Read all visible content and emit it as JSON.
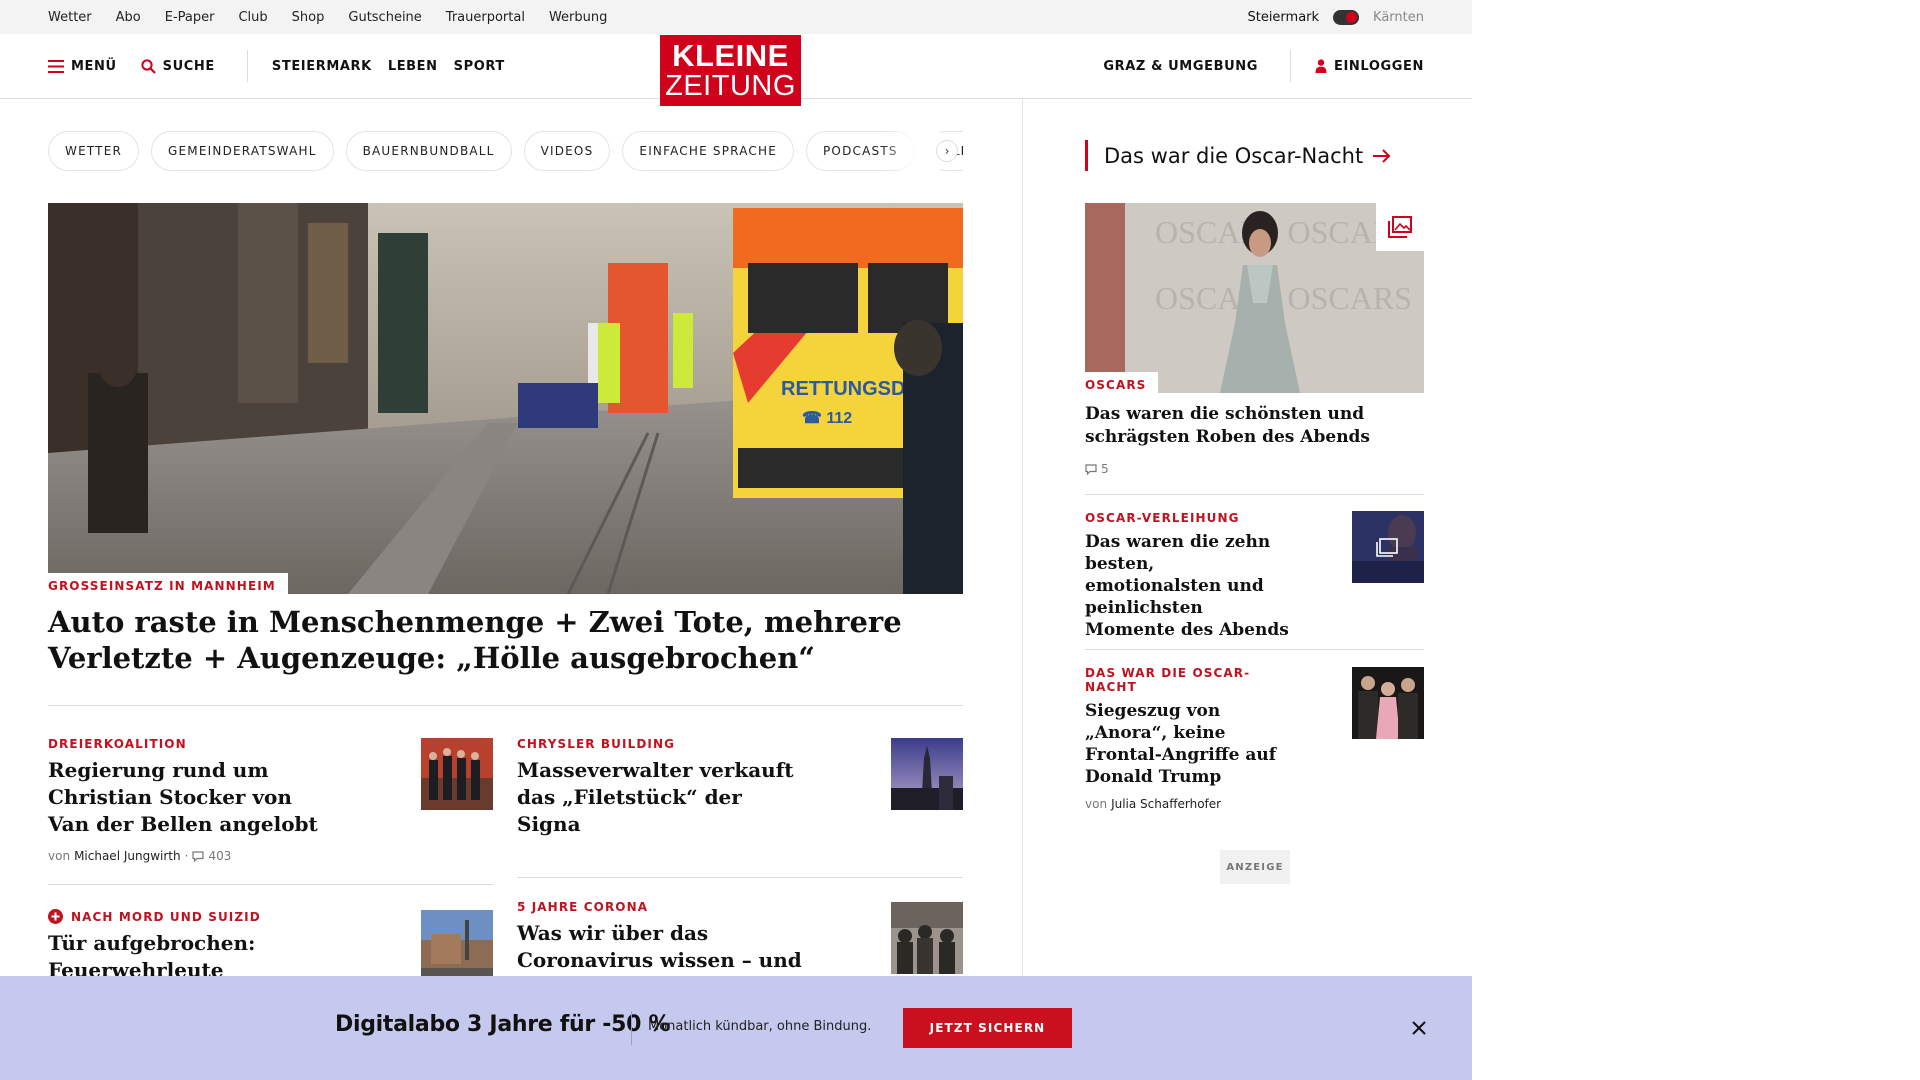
{
  "utility": {
    "links": [
      "Wetter",
      "Abo",
      "E-Paper",
      "Club",
      "Shop",
      "Gutscheine",
      "Trauerportal",
      "Werbung"
    ],
    "region_active": "Steiermark",
    "region_other": "Kärnten"
  },
  "nav": {
    "menu": "MENÜ",
    "search": "SUCHE",
    "sections": [
      "STEIERMARK",
      "LEBEN",
      "SPORT"
    ],
    "local": "GRAZ & UMGEBUNG",
    "login": "EINLOGGEN"
  },
  "logo": {
    "line1": "KLEINE",
    "line2": "ZEITUNG"
  },
  "chips": [
    "WETTER",
    "GEMEINDERATSWAHL",
    "BAUERNBUNDBALL",
    "VIDEOS",
    "EINFACHE SPRACHE",
    "PODCASTS",
    "KLEINE KINDERZEITUNG"
  ],
  "hero": {
    "kicker": "GROSSEINSATZ IN MANNHEIM",
    "title": "Auto raste in Menschenmenge + Zwei Tote, mehrere Verletzte + Augenzeuge: „Hölle ausgebrochen“",
    "image_text": "RETTUNGSDIENST",
    "image_number": "☎ 112"
  },
  "articles": [
    {
      "kicker": "DREIERKOALITION",
      "title": "Regierung rund um Christian Stocker von Van der Bellen angelobt",
      "by": "von",
      "author": "Michael Jungwirth",
      "comments": "403"
    },
    {
      "kicker": "CHRYSLER BUILDING",
      "title": "Masseverwalter verkauft das „Filetstück“ der Signa"
    },
    {
      "kicker": "NACH MORD UND SUIZID",
      "title": "Tür aufgebrochen: Feuerwehrleute entdeckten"
    },
    {
      "kicker": "5 JAHRE CORONA",
      "title": "Was wir über das Coronavirus wissen – und was nicht"
    }
  ],
  "sidebar": {
    "heading": "Das war die Oscar-Nacht",
    "feature": {
      "image_text": "OSCARS OSCARS",
      "kicker": "OSCARS",
      "title": "Das waren die schönsten und schrägsten Roben des Abends",
      "comments": "5"
    },
    "items": [
      {
        "kicker": "OSCAR-VERLEIHUNG",
        "title": "Das waren die zehn besten, emotionalsten und peinlichsten Momente des Abends"
      },
      {
        "kicker": "DAS WAR DIE OSCAR-NACHT",
        "title": "Siegeszug von „Anora“, keine Frontal-Angriffe auf Donald Trump",
        "by": "von",
        "author": "Julia Schafferhofer"
      }
    ],
    "ad_label": "ANZEIGE"
  },
  "promo": {
    "title": "Digitalabo 3 Jahre für -50 %",
    "subtitle": "Monatlich kündbar, ohne Bindung.",
    "button": "JETZT SICHERN"
  },
  "colors": {
    "brand_red": "#d0021b",
    "kicker_red": "#c1121f",
    "promo_bg": "#c5c9ee"
  }
}
